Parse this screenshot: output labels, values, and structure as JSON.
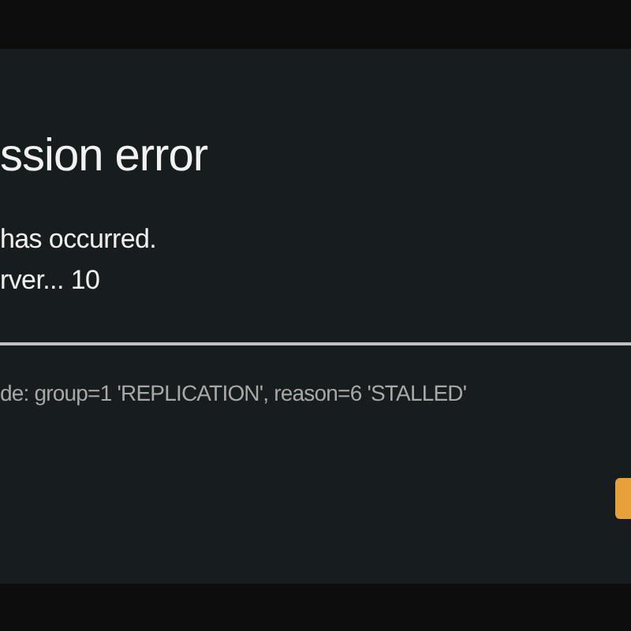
{
  "dialog": {
    "title": "ssion error",
    "message_lines": [
      "has occurred.",
      "rver... 10"
    ],
    "detail": "de: group=1 'REPLICATION', reason=6 'STALLED'"
  }
}
